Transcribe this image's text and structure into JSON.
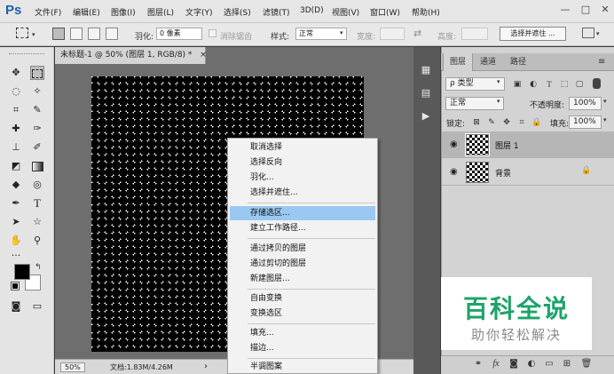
{
  "app": {
    "logo": "Ps"
  },
  "menubar": {
    "items": [
      "文件(F)",
      "编辑(E)",
      "图像(I)",
      "图层(L)",
      "文字(Y)",
      "选择(S)",
      "滤镜(T)",
      "3D(D)",
      "视图(V)",
      "窗口(W)",
      "帮助(H)"
    ],
    "window_controls": [
      "—",
      "□",
      "✕"
    ]
  },
  "options": {
    "feather_label": "羽化:",
    "feather_value": "0 像素",
    "antialias_label": "消除锯齿",
    "style_label": "样式:",
    "style_value": "正常",
    "width_label": "宽度:",
    "height_label": "高度:",
    "select_mask_button": "选择并遮住 ..."
  },
  "document": {
    "tab_title": "未标题-1 @ 50% (图层 1, RGB/8) *",
    "tab_close": "×",
    "zoom": "50%",
    "doc_info": "文档:1.83M/4.26M",
    "status_arrow": "›"
  },
  "context_menu": {
    "groups": [
      [
        "取消选择",
        "选择反向",
        "羽化...",
        "选择并遮住..."
      ],
      [
        "存储选区...",
        "建立工作路径..."
      ],
      [
        "通过拷贝的图层",
        "通过剪切的图层",
        "新建图层..."
      ],
      [
        "自由变换",
        "变换选区"
      ],
      [
        "填充...",
        "描边..."
      ],
      [
        "半调图案"
      ]
    ],
    "highlighted": "存储选区..."
  },
  "layers_panel": {
    "tabs": [
      "图层",
      "通道",
      "路径"
    ],
    "active_tab": "图层",
    "filter_kind": "ρ 类型",
    "blend_mode": "正常",
    "opacity_label": "不透明度:",
    "opacity_value": "100%",
    "lock_label": "锁定:",
    "fill_label": "填充:",
    "fill_value": "100%",
    "layers": [
      {
        "name": "图层 1",
        "selected": true,
        "locked": false
      },
      {
        "name": "背景",
        "selected": false,
        "locked": true
      }
    ],
    "bottom_icons": [
      "link-icon",
      "fx-icon",
      "mask-icon",
      "adjustment-icon",
      "group-icon",
      "new-layer-icon",
      "trash-icon"
    ]
  },
  "watermark": {
    "title": "百科全说",
    "subtitle": "助你轻松解决"
  },
  "colors": {
    "highlight": "#99c9f2",
    "watermark_green": "#1ea36a",
    "ps_blue": "#1f5fa8"
  }
}
